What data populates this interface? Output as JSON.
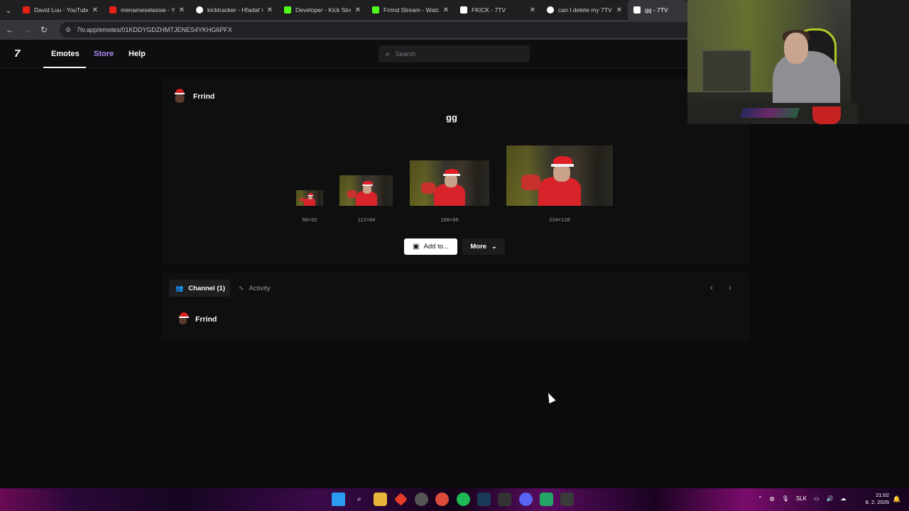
{
  "browser": {
    "tabs": [
      {
        "label": "David Luu - YouTube",
        "favicon_color": "#e62117"
      },
      {
        "label": "menameselassie - Yo",
        "favicon_color": "#e62117"
      },
      {
        "label": "kicktracker - Hľadať G",
        "favicon_color": "#ffffff"
      },
      {
        "label": "Developer - Kick Stre",
        "favicon_color": "#53fc18"
      },
      {
        "label": "Frrind Stream - Watc",
        "favicon_color": "#53fc18"
      },
      {
        "label": "FKICK - 7TV",
        "favicon_color": "#ffffff"
      },
      {
        "label": "can I delete my 7TV a",
        "favicon_color": "#ffffff"
      },
      {
        "label": "gg - 7TV",
        "favicon_color": "#ffffff",
        "active": true
      }
    ],
    "url": "7tv.app/emotes/01KDDYGDZHMTJENES4YKHG6PFX"
  },
  "site_nav": {
    "logo": "7",
    "links": [
      "Emotes",
      "Store",
      "Help"
    ],
    "search_placeholder": "Search"
  },
  "emote": {
    "owner": "Frrind",
    "name": "gg",
    "sizes": [
      "56×32",
      "112×64",
      "168×96",
      "224×128"
    ],
    "add_label": "Add to...",
    "more_label": "More"
  },
  "tabs_section": {
    "channel_tab": "Channel (1)",
    "activity_tab": "Activity",
    "channels": [
      "Frrind"
    ]
  },
  "taskbar": {
    "lang": "SLK",
    "time": "21:02",
    "date": "8. 2. 2026",
    "apps": [
      "windows-icon",
      "search-icon",
      "explorer-icon",
      "app-icon",
      "chrome-icon",
      "chrome-icon",
      "spotify-icon",
      "steam-icon",
      "app-icon",
      "discord-icon",
      "sheets-icon",
      "app-icon"
    ]
  }
}
